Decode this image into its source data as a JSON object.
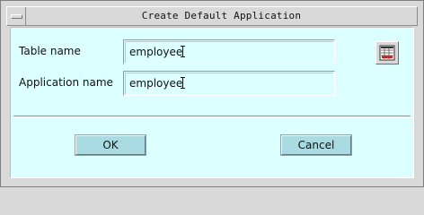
{
  "window": {
    "title": "Create Default Application"
  },
  "form": {
    "table_name_label": "Table name",
    "table_name_value": "employee",
    "application_name_label": "Application name",
    "application_name_value": "employee"
  },
  "toolbar": {
    "picker_icon": "table-grid-icon"
  },
  "buttons": {
    "ok_label": "OK",
    "cancel_label": "Cancel"
  },
  "colors": {
    "client_background": "#dcffff",
    "button_face": "#aadbe2",
    "frame": "#d9d9d9",
    "icon_accent": "#cc1f1f"
  }
}
